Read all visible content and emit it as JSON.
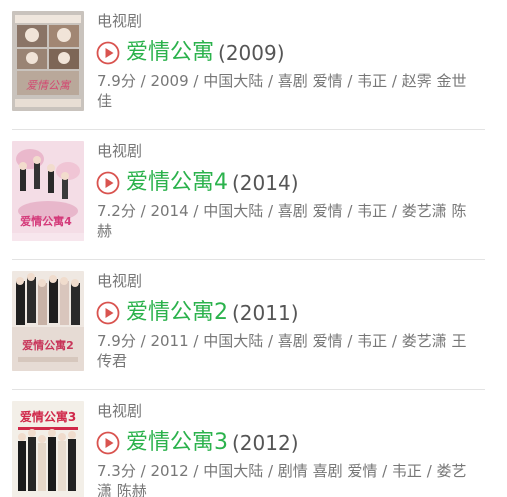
{
  "items": [
    {
      "type": "电视剧",
      "title": "爱情公寓",
      "year": "(2009)",
      "meta": "7.9分 / 2009 / 中国大陆 / 喜剧 爱情 / 韦正 / 赵霁 金世佳",
      "poster_icon": "movie-poster",
      "poster_palette": [
        "#c9c3bd",
        "#6b5547",
        "#f1e4d8",
        "#d24a72"
      ]
    },
    {
      "type": "电视剧",
      "title": "爱情公寓4",
      "year": "(2014)",
      "meta": "7.2分 / 2014 / 中国大陆 / 喜剧 爱情 / 韦正 / 娄艺潇 陈赫",
      "poster_icon": "movie-poster",
      "poster_palette": [
        "#f4dde6",
        "#2a2a2a",
        "#e8b7cb",
        "#d43a7a"
      ]
    },
    {
      "type": "电视剧",
      "title": "爱情公寓2",
      "year": "(2011)",
      "meta": "7.9分 / 2011 / 中国大陆 / 喜剧 爱情 / 韦正 / 娄艺潇 王传君",
      "poster_icon": "movie-poster",
      "poster_palette": [
        "#efe8e2",
        "#1f1f1f",
        "#d9c6bd",
        "#c8365a"
      ]
    },
    {
      "type": "电视剧",
      "title": "爱情公寓3",
      "year": "(2012)",
      "meta": "7.3分 / 2012 / 中国大陆 / 剧情 喜剧 爱情 / 韦正 / 娄艺潇 陈赫",
      "poster_icon": "movie-poster",
      "poster_palette": [
        "#f3efe8",
        "#1b1b1b",
        "#e6d8c9",
        "#d0284a"
      ]
    }
  ],
  "colors": {
    "accent": "#2bb24c",
    "play_icon": "#d9534f",
    "muted_text": "#777777",
    "divider": "#e3e3e3"
  }
}
